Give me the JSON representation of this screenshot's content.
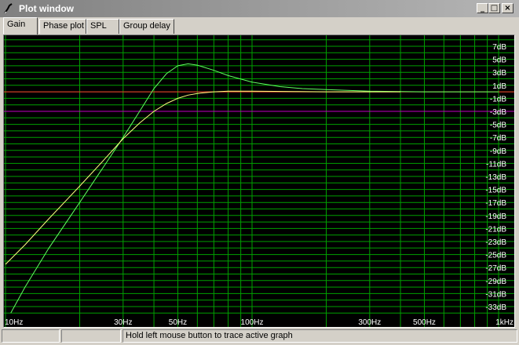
{
  "window": {
    "title": "Plot window",
    "minimize_glyph": "_",
    "maximize_glyph": "□",
    "close_glyph": "×"
  },
  "tabs": [
    {
      "label": "Gain",
      "active": true
    },
    {
      "label": "Phase plot",
      "active": false
    },
    {
      "label": "SPL",
      "active": false
    },
    {
      "label": "Group delay",
      "active": false
    }
  ],
  "status": {
    "message": "Hold left mouse button to trace active graph"
  },
  "chart_data": {
    "type": "line",
    "x_scale": "log",
    "xlim": [
      10,
      1000
    ],
    "ylim": [
      -34,
      8
    ],
    "x_tick_labels": [
      {
        "x": 10,
        "label": "10Hz"
      },
      {
        "x": 30,
        "label": "30Hz"
      },
      {
        "x": 50,
        "label": "50Hz"
      },
      {
        "x": 100,
        "label": "100Hz"
      },
      {
        "x": 300,
        "label": "300Hz"
      },
      {
        "x": 500,
        "label": "500Hz"
      },
      {
        "x": 1000,
        "label": "1kHz"
      }
    ],
    "y_tick_labels": [
      "7dB",
      "5dB",
      "3dB",
      "1dB",
      "-1dB",
      "-3dB",
      "-5dB",
      "-7dB",
      "-9dB",
      "-11dB",
      "-13dB",
      "-15dB",
      "-17dB",
      "-19dB",
      "-21dB",
      "-23dB",
      "-25dB",
      "-27dB",
      "-29dB",
      "-31dB",
      "-33dB"
    ],
    "grid": true,
    "reference_lines": [
      {
        "y": 0,
        "color": "#ff3030"
      },
      {
        "y": -3,
        "color": "#c000c0"
      }
    ],
    "colors": {
      "background": "#000000",
      "grid": "#00a000",
      "axis_labels": "#ffffff"
    },
    "series": [
      {
        "color": "#60ff60",
        "x": [
          10.5,
          12,
          15,
          20,
          25,
          30,
          35,
          40,
          45,
          50,
          55,
          60,
          70,
          80,
          100,
          130,
          160,
          200,
          250,
          300,
          400,
          500,
          700,
          1000
        ],
        "y": [
          -34,
          -30,
          -24,
          -17,
          -11.5,
          -7,
          -3,
          0.5,
          2.8,
          4,
          4.3,
          4.1,
          3.3,
          2.5,
          1.5,
          0.8,
          0.5,
          0.35,
          0.2,
          0.1,
          0.05,
          0,
          0,
          0
        ]
      },
      {
        "color": "#ffff80",
        "x": [
          10,
          12,
          15,
          20,
          25,
          30,
          35,
          40,
          45,
          50,
          55,
          60,
          70,
          80,
          100,
          150,
          200,
          300,
          400
        ],
        "y": [
          -26.5,
          -23.5,
          -19.5,
          -14.5,
          -10.5,
          -7.2,
          -4.8,
          -3,
          -1.8,
          -1,
          -0.5,
          -0.25,
          0,
          0.1,
          0.1,
          0.05,
          0,
          0,
          0
        ]
      }
    ]
  }
}
